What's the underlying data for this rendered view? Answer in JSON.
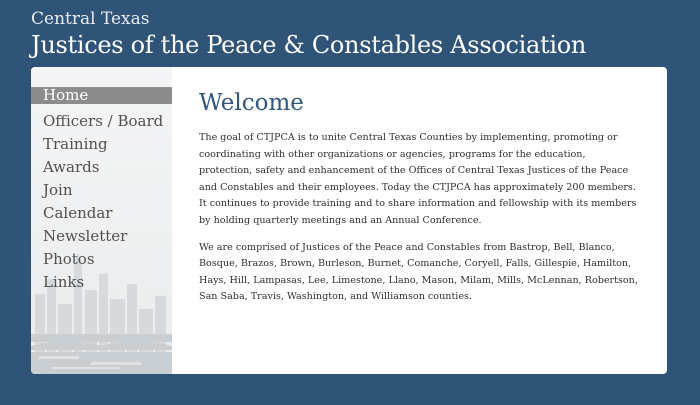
{
  "header": {
    "subtitle": "Central Texas",
    "title": "Justices of the Peace & Constables Association"
  },
  "nav": {
    "items": [
      {
        "label": "Home"
      },
      {
        "label": "Officers / Board"
      },
      {
        "label": "Training"
      },
      {
        "label": "Awards"
      },
      {
        "label": "Join"
      },
      {
        "label": "Calendar"
      },
      {
        "label": "Newsletter"
      },
      {
        "label": "Photos"
      },
      {
        "label": "Links"
      }
    ],
    "active_index": 0
  },
  "content": {
    "heading": "Welcome",
    "paragraphs": [
      "The goal of CTJPCA is to unite Central Texas Counties by implementing, promoting or coordinating with other organizations or agencies, programs for the education, protection, safety and enhancement of the Offices of Central Texas Justices of the Peace and Constables and their employees. Today the CTJPCA has approximately 200 members. It continues to provide training and to share information and fellowship with its members by holding quarterly meetings and an Annual Conference.",
      "We are comprised of Justices of the Peace and Constables from Bastrop, Bell, Blanco, Bosque, Brazos, Brown, Burleson, Burnet, Comanche, Coryell, Falls, Gillespie, Hamilton, Hays, Hill, Lampasas, Lee, Limestone, Llano, Mason, Milam, Mills, McLennan, Robertson, San Saba, Travis, Washington, and Williamson counties."
    ]
  },
  "colors": {
    "background": "#2f5478",
    "nav_active": "#8c8c8c",
    "heading": "#33577c"
  }
}
